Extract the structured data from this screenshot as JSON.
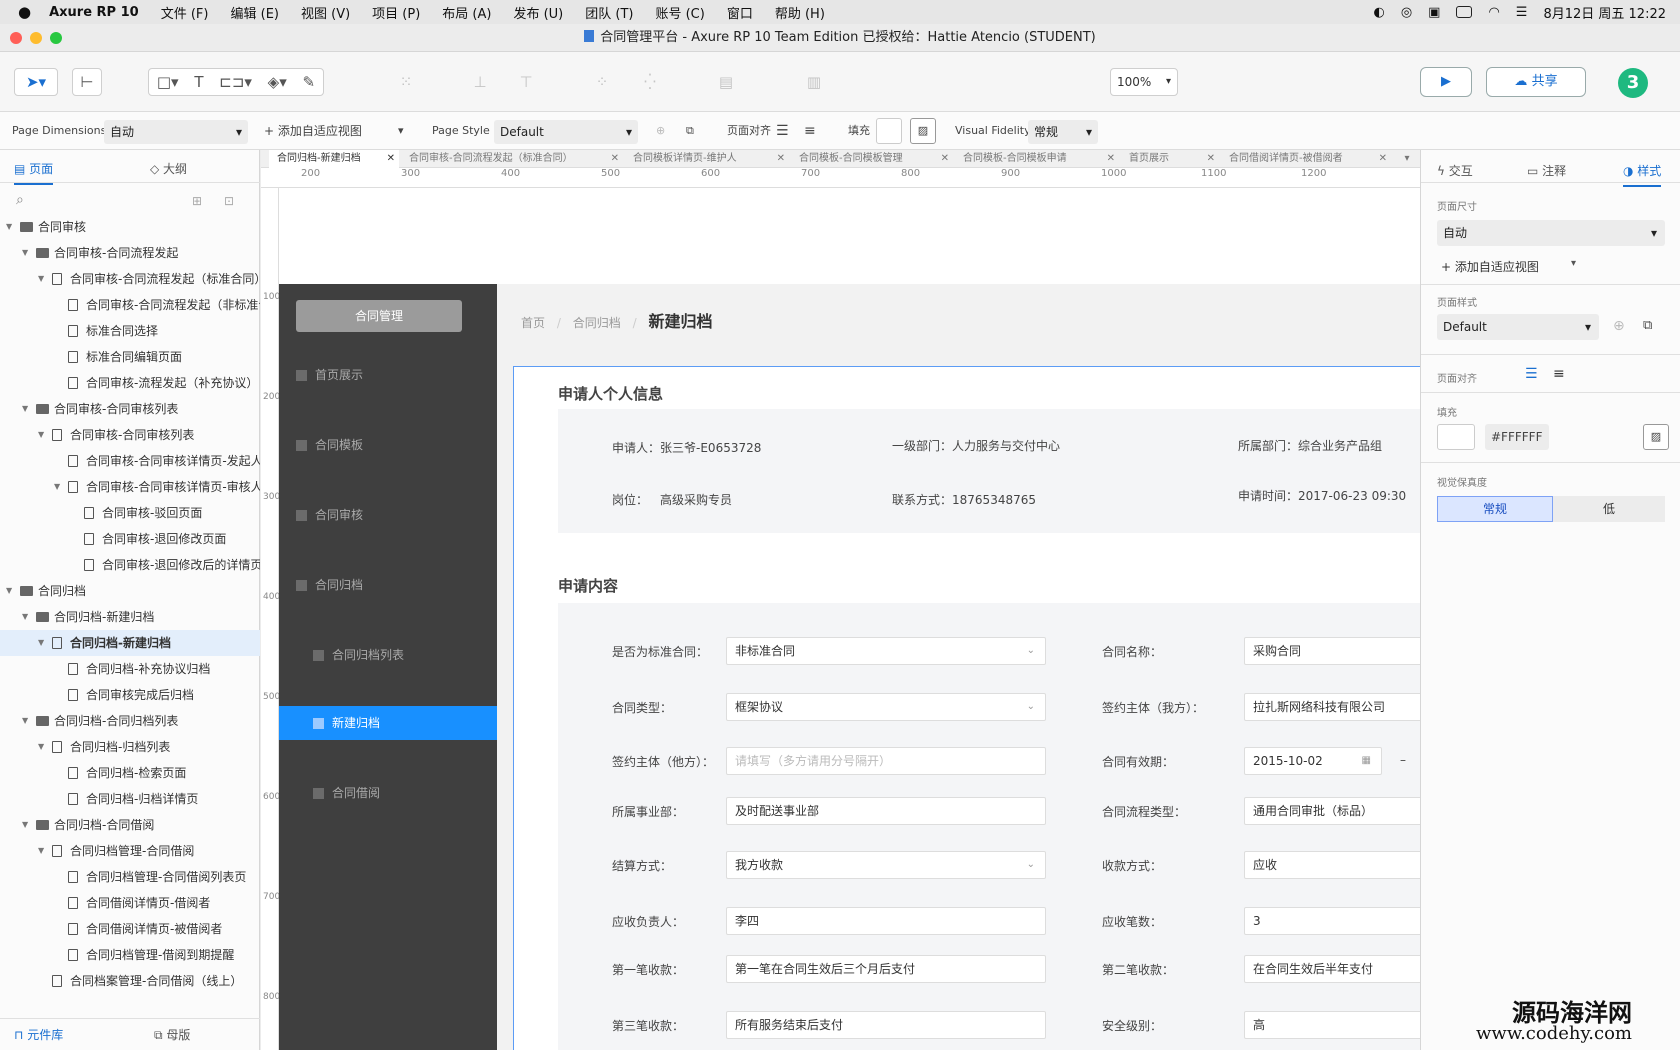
{
  "menubar": {
    "app": "Axure RP 10",
    "items": [
      "文件 (F)",
      "编辑 (E)",
      "视图 (V)",
      "项目 (P)",
      "布局 (A)",
      "发布 (U)",
      "团队 (T)",
      "账号 (C)",
      "窗口",
      "帮助 (H)"
    ],
    "datetime": "8月12日 周五  12:22"
  },
  "window": {
    "title": "合同管理平台 - Axure RP 10 Team Edition  已授权给：Hattie Atencio (STUDENT)"
  },
  "toolbar": {
    "zoom": "100%",
    "share": "共享",
    "avatar": "3"
  },
  "pageprops": {
    "dim_label": "Page Dimensions",
    "dim_value": "自动",
    "adaptive": "+ 添加自适应视图",
    "style_label": "Page Style",
    "style_value": "Default",
    "align_label": "页面对齐",
    "fill_label": "填充",
    "fidelity_label": "Visual Fidelity",
    "fidelity_value": "常规"
  },
  "left": {
    "tab_pages": "页面",
    "tab_outline": "大纲",
    "bottom_lib": "元件库",
    "bottom_master": "母版",
    "tree": [
      {
        "label": "合同审核",
        "type": "folder",
        "level": 0
      },
      {
        "label": "合同审核-合同流程发起",
        "type": "folder",
        "level": 1
      },
      {
        "label": "合同审核-合同流程发起（标准合同）",
        "type": "page",
        "level": 2,
        "exp": true
      },
      {
        "label": "合同审核-合同流程发起（非标准合同）",
        "type": "page",
        "level": 3
      },
      {
        "label": "标准合同选择",
        "type": "page",
        "level": 3
      },
      {
        "label": "标准合同编辑页面",
        "type": "page",
        "level": 3
      },
      {
        "label": "合同审核-流程发起（补充协议）",
        "type": "page",
        "level": 3
      },
      {
        "label": "合同审核-合同审核列表",
        "type": "folder",
        "level": 1
      },
      {
        "label": "合同审核-合同审核列表",
        "type": "page",
        "level": 2,
        "exp": true
      },
      {
        "label": "合同审核-合同审核详情页-发起人",
        "type": "page",
        "level": 3
      },
      {
        "label": "合同审核-合同审核详情页-审核人",
        "type": "page",
        "level": 3,
        "exp": true
      },
      {
        "label": "合同审核-驳回页面",
        "type": "page",
        "level": 4
      },
      {
        "label": "合同审核-退回修改页面",
        "type": "page",
        "level": 4
      },
      {
        "label": "合同审核-退回修改后的详情页",
        "type": "page",
        "level": 4
      },
      {
        "label": "合同归档",
        "type": "folder",
        "level": 0
      },
      {
        "label": "合同归档-新建归档",
        "type": "folder",
        "level": 1
      },
      {
        "label": "合同归档-新建归档",
        "type": "page",
        "level": 2,
        "exp": true,
        "sel": true
      },
      {
        "label": "合同归档-补充协议归档",
        "type": "page",
        "level": 3
      },
      {
        "label": "合同审核完成后归档",
        "type": "page",
        "level": 3
      },
      {
        "label": "合同归档-合同归档列表",
        "type": "folder",
        "level": 1
      },
      {
        "label": "合同归档-归档列表",
        "type": "page",
        "level": 2,
        "exp": true
      },
      {
        "label": "合同归档-检索页面",
        "type": "page",
        "level": 3
      },
      {
        "label": "合同归档-归档详情页",
        "type": "page",
        "level": 3
      },
      {
        "label": "合同归档-合同借阅",
        "type": "folder",
        "level": 1
      },
      {
        "label": "合同归档管理-合同借阅",
        "type": "page",
        "level": 2,
        "exp": true
      },
      {
        "label": "合同归档管理-合同借阅列表页",
        "type": "page",
        "level": 3
      },
      {
        "label": "合同借阅详情页-借阅者",
        "type": "page",
        "level": 3
      },
      {
        "label": "合同借阅详情页-被借阅者",
        "type": "page",
        "level": 3
      },
      {
        "label": "合同归档管理-借阅到期提醒",
        "type": "page",
        "level": 3
      },
      {
        "label": "合同档案管理-合同借阅（线上）",
        "type": "page",
        "level": 2
      }
    ]
  },
  "tabs": [
    "合同归档-新建归档",
    "合同审核-合同流程发起（标准合同）",
    "合同模板详情页-维护人",
    "合同模板-合同模板管理",
    "合同模板-合同模板申请",
    "首页展示",
    "合同借阅详情页-被借阅者"
  ],
  "ruler": {
    "h": [
      "200",
      "300",
      "400",
      "500",
      "600",
      "700",
      "800",
      "900",
      "1000",
      "1100",
      "1200"
    ],
    "v": [
      "100",
      "200",
      "300",
      "400",
      "500",
      "600",
      "700",
      "800"
    ]
  },
  "proto": {
    "side_btn": "合同管理",
    "side_items": [
      "首页展示",
      "合同模板",
      "合同审核",
      "合同归档",
      "合同归档列表",
      "新建归档",
      "合同借阅"
    ],
    "crumbs": {
      "home": "首页",
      "sep": "/",
      "mid": "合同归档",
      "cur": "新建归档"
    },
    "sec1": "申请人个人信息",
    "info": [
      {
        "k": "申请人：",
        "v": "张三爷-E0653728"
      },
      {
        "k": "一级部门：",
        "v": "人力服务与交付中心"
      },
      {
        "k": "所属部门：",
        "v": "综合业务产品组"
      },
      {
        "k": "岗位：",
        "v": "高级采购专员"
      },
      {
        "k": "联系方式：",
        "v": "18765348765"
      },
      {
        "k": "申请时间：",
        "v": "2017-06-23 09:30"
      }
    ],
    "sec2": "申请内容",
    "form": [
      {
        "l": "是否为标准合同：",
        "v": "非标准合同",
        "dd": true,
        "l2": "合同名称：",
        "v2": "采购合同"
      },
      {
        "l": "合同类型：",
        "v": "框架协议",
        "dd": true,
        "l2": "签约主体（我方）：",
        "v2": "拉扎斯网络科技有限公司"
      },
      {
        "l": "签约主体（他方）：",
        "v": "请填写（多方请用分号隔开）",
        "ph": true,
        "l2": "合同有效期：",
        "v2": "2015-10-02",
        "extra": "–"
      },
      {
        "l": "所属事业部：",
        "v": "及时配送事业部",
        "l2": "合同流程类型：",
        "v2": "通用合同审批（标品）"
      },
      {
        "l": "结算方式：",
        "v": "我方收款",
        "dd": true,
        "l2": "收款方式：",
        "v2": "应收"
      },
      {
        "l": "应收负责人：",
        "v": "李四",
        "l2": "应收笔数：",
        "v2": "3"
      },
      {
        "l": "第一笔收款：",
        "v": "第一笔在合同生效后三个月后支付",
        "l2": "第二笔收款：",
        "v2": "在合同生效后半年支付"
      },
      {
        "l": "第三笔收款：",
        "v": "所有服务结束后支付",
        "l2": "安全级别：",
        "v2": "高"
      }
    ]
  },
  "right": {
    "tab1": "交互",
    "tab2": "注释",
    "tab3": "样式",
    "dim": "页面尺寸",
    "dim_v": "自动",
    "adaptive": "+ 添加自适应视图",
    "pstyle": "页面样式",
    "pstyle_v": "Default",
    "align": "页面对齐",
    "fill": "填充",
    "fill_hex": "#FFFFFF",
    "fid": "视觉保真度",
    "fid_a": "常规",
    "fid_b": "低"
  },
  "watermark": {
    "l1": "源码海洋网",
    "l2": "www.codehy.com"
  },
  "colors": {
    "accent": "#1890ff",
    "sidebar": "#3f3f3f",
    "avatar": "#1eb980",
    "selection": "#5c9cf5"
  }
}
